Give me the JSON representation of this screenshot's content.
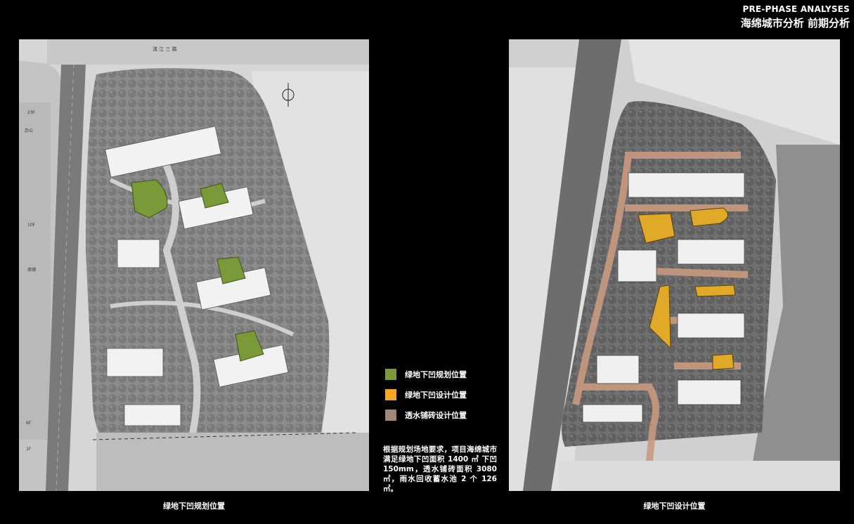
{
  "header": {
    "title_en": "PRE-PHASE ANALYSES",
    "title_zh": "海绵城市分析 前期分析"
  },
  "left_panel": {
    "caption": "绿地下凹规划位置",
    "road_label": "滨 江 三 路",
    "labels": [
      "23F",
      "办公",
      "10F",
      "商铺",
      "6F",
      "1F"
    ]
  },
  "right_panel": {
    "caption": "绿地下凹设计位置"
  },
  "legend": {
    "items": [
      {
        "label": "绿地下凹规划位置",
        "color": "#7a9a3a"
      },
      {
        "label": "绿地下凹设计位置",
        "color": "#f5a623"
      },
      {
        "label": "透水铺砖设计位置",
        "color": "#a08878"
      }
    ]
  },
  "description": "根据规划场地要求，项目海绵城市满足绿地下凹面积 1400 ㎡ 下凹 150mm，透水铺砖面积 3080 ㎡，雨水回收蓄水池 2 个 126 ㎡。",
  "colors": {
    "green_zone": "#7a9a3a",
    "orange_zone": "#e0a928",
    "paving": "#c89a80"
  }
}
